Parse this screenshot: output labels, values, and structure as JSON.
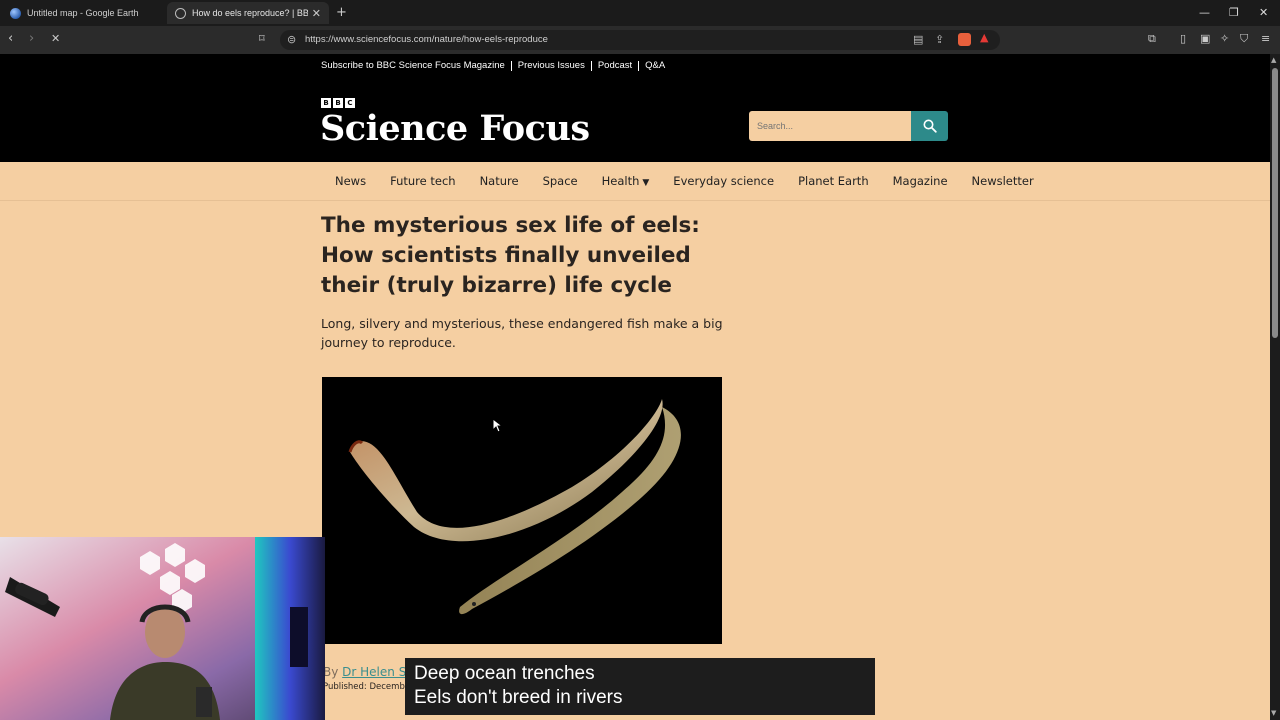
{
  "browser": {
    "tabs": [
      {
        "label": "Untitled map - Google Earth",
        "active": false
      },
      {
        "label": "How do eels reproduce? | BBC Sc",
        "active": true
      }
    ],
    "url": "https://www.sciencefocus.com/nature/how-eels-reproduce"
  },
  "site": {
    "top_links": [
      "Subscribe to BBC Science Focus Magazine",
      "Previous Issues",
      "Podcast",
      "Q&A"
    ],
    "logo_bbc": [
      "B",
      "B",
      "C"
    ],
    "logo_text": "Science Focus",
    "search_placeholder": "Search...",
    "nav": [
      "News",
      "Future tech",
      "Nature",
      "Space",
      "Health",
      "Everyday science",
      "Planet Earth",
      "Magazine",
      "Newsletter"
    ]
  },
  "article": {
    "headline": "The mysterious sex life of eels: How scientists finally unveiled their (truly bizarre) life cycle",
    "standfirst": "Long, silvery and mysterious, these endangered fish make a big journey to reproduce.",
    "byline_prefix": "By ",
    "author": "Dr Helen Sc",
    "published": "Published: December"
  },
  "caption": {
    "line1": "Deep ocean trenches",
    "line2": "Eels don't breed in rivers"
  },
  "colors": {
    "page_bg": "#f5cfa2",
    "header_bg": "#000000",
    "accent_teal": "#2d8a8a"
  }
}
